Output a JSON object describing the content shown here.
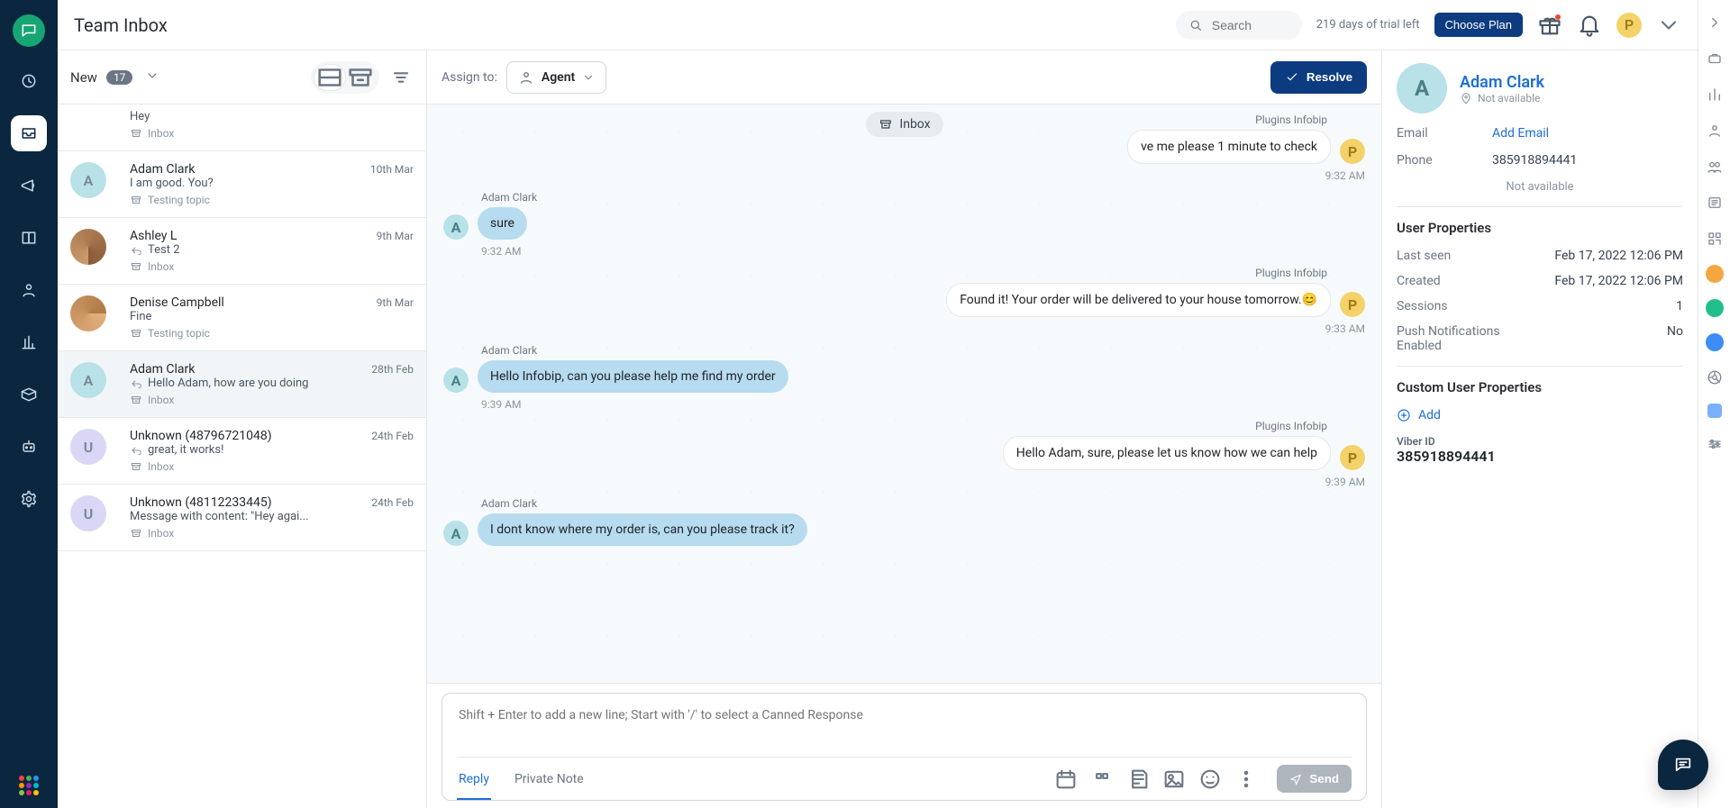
{
  "header": {
    "title": "Team Inbox",
    "search_placeholder": "Search",
    "trial_text": "219 days of trial left",
    "choose_plan": "Choose Plan",
    "user_initial": "P"
  },
  "list": {
    "label": "New",
    "count": "17",
    "conversations": [
      {
        "initial": "",
        "name": "",
        "preview": "Hey",
        "channel": "Inbox",
        "date": "",
        "avatar_class": "bg-u"
      },
      {
        "initial": "A",
        "name": "Adam Clark",
        "preview": "I am good. You?",
        "channel": "Testing topic",
        "date": "10th Mar",
        "avatar_class": "bg-a"
      },
      {
        "initial": "",
        "name": "Ashley L",
        "preview": "Test 2",
        "channel": "Inbox",
        "date": "9th Mar",
        "avatar_class": "bg-photo1",
        "is_reply": true
      },
      {
        "initial": "",
        "name": "Denise Campbell",
        "preview": "Fine",
        "channel": "Testing topic",
        "date": "9th Mar",
        "avatar_class": "bg-photo2"
      },
      {
        "initial": "A",
        "name": "Adam Clark",
        "preview": "Hello Adam, how are you doing",
        "channel": "Inbox",
        "date": "28th Feb",
        "avatar_class": "bg-a",
        "is_reply": true,
        "selected": true
      },
      {
        "initial": "U",
        "name": "Unknown (48796721048)",
        "preview": "great, it works!",
        "channel": "Inbox",
        "date": "24th Feb",
        "avatar_class": "bg-u",
        "is_reply": true
      },
      {
        "initial": "U",
        "name": "Unknown (48112233445)",
        "preview": "Message with content: \"Hey agai...",
        "channel": "Inbox",
        "date": "24th Feb",
        "avatar_class": "bg-u"
      }
    ]
  },
  "chat_header": {
    "assign_to": "Assign to:",
    "agent_label": "Agent",
    "resolve": "Resolve",
    "tray_inbox_label": "Inbox"
  },
  "messages": [
    {
      "side": "right",
      "sender": "Plugins Infobip",
      "avatar": "P",
      "avatar_class": "bg-p",
      "text": "ve me please 1 minute to check",
      "time": "9:32 AM"
    },
    {
      "side": "left",
      "sender": "Adam Clark",
      "avatar": "A",
      "avatar_class": "bg-a",
      "text": "sure",
      "time": "9:32 AM"
    },
    {
      "side": "right",
      "sender": "Plugins Infobip",
      "avatar": "P",
      "avatar_class": "bg-p",
      "text": "Found it! Your order will be delivered to your house tomorrow.😊",
      "time": "9:33 AM"
    },
    {
      "side": "left",
      "sender": "Adam Clark",
      "avatar": "A",
      "avatar_class": "bg-a",
      "text": "Hello Infobip, can you please help me find my order",
      "time": "9:39 AM"
    },
    {
      "side": "right",
      "sender": "Plugins Infobip",
      "avatar": "P",
      "avatar_class": "bg-p",
      "text": "Hello Adam, sure, please let us know how we can help",
      "time": "9:39 AM"
    },
    {
      "side": "left",
      "sender": "Adam Clark",
      "avatar": "A",
      "avatar_class": "bg-a",
      "text": "I dont know where my order is, can you please track it?",
      "time": ""
    }
  ],
  "composer": {
    "placeholder": "Shift + Enter to add a new line; Start with '/' to select a Canned Response",
    "tabs": {
      "reply": "Reply",
      "private_note": "Private Note"
    },
    "send": "Send"
  },
  "profile": {
    "initial": "A",
    "name": "Adam Clark",
    "not_available_short": "Not available",
    "email_label": "Email",
    "add_email": "Add Email",
    "phone_label": "Phone",
    "phone_value": "385918894441",
    "not_available_long": "Not available",
    "user_properties": "User Properties",
    "last_seen_label": "Last seen",
    "last_seen_value": "Feb 17, 2022 12:06 PM",
    "created_label": "Created",
    "created_value": "Feb 17, 2022 12:06 PM",
    "sessions_label": "Sessions",
    "sessions_value": "1",
    "push_label": "Push Notifications Enabled",
    "push_value": "No",
    "custom_title": "Custom User Properties",
    "add_label": "Add",
    "viber_id_label": "Viber ID",
    "viber_id_value": "385918894441"
  }
}
